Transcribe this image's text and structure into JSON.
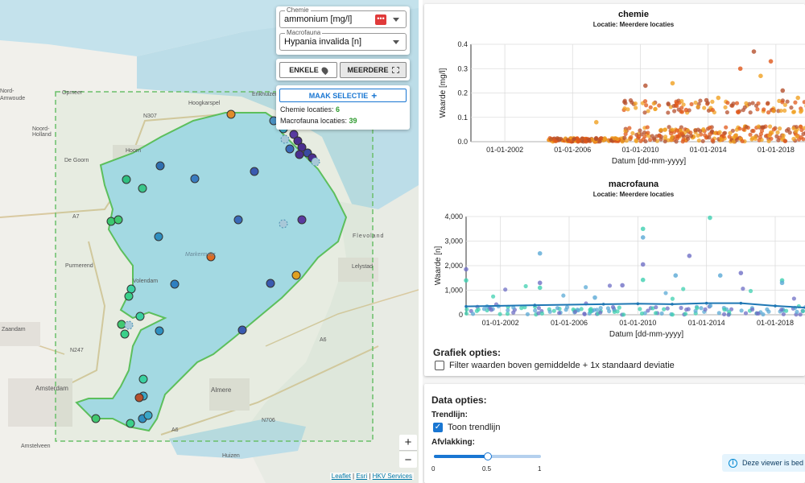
{
  "map": {
    "labels": [
      "Opmeer",
      "Hoogkarspel",
      "Enkhuizen",
      "Noord-\nHolland",
      "Hoorn",
      "De Goorn",
      "Purmerend",
      "Volendam",
      "Zaandam",
      "Amsterdam",
      "Almere",
      "Lelystad",
      "Flevoland",
      "Amstelveen",
      "Huizen",
      "Markermeer",
      "Monnickendam",
      "Hoofdweg",
      "A7",
      "N307",
      "N247",
      "A6",
      "N706",
      "A1",
      "A6",
      "Nord-",
      "Amwoude"
    ],
    "zoom_in": "+",
    "zoom_out": "−",
    "attribution": {
      "leaflet": "Leaflet",
      "sep1": " | ",
      "esri": "Esri",
      "sep2": " | ",
      "hkv": "HKV Services"
    }
  },
  "controls": {
    "chemie_label": "Chemie",
    "chemie_value": "ammonium [mg/l]",
    "macrofauna_label": "Macrofauna",
    "macrofauna_value": "Hypania invalida [n]",
    "enkele": "ENKELE",
    "meerdere": "MEERDERE",
    "maak_selectie": "MAAK SELECTIE",
    "plus": "+",
    "chemie_locaties_label": "Chemie locaties: ",
    "chemie_locaties": "6",
    "macrofauna_locaties_label": "Macrofauna locaties: ",
    "macrofauna_locaties": "39"
  },
  "charts": {
    "chemie": {
      "title": "chemie",
      "subtitle": "Locatie: Meerdere locaties",
      "ylabel": "Waarde [mg/l]",
      "xlabel": "Datum [dd-mm-yyyy]",
      "yticks": [
        "0.4",
        "0.3",
        "0.2",
        "0.1",
        "0.0"
      ],
      "xticks": [
        "01-01-2002",
        "01-01-2006",
        "01-01-2010",
        "01-01-2014",
        "01-01-2018"
      ]
    },
    "macrofauna": {
      "title": "macrofauna",
      "subtitle": "Locatie: Meerdere locaties",
      "ylabel": "Waarde [n]",
      "xlabel": "Datum [dd-mm-yyyy]",
      "yticks": [
        "4,000",
        "3,000",
        "2,000",
        "1,000",
        "0"
      ],
      "xticks": [
        "01-01-2002",
        "01-01-2006",
        "01-01-2010",
        "01-01-2014",
        "01-01-2018"
      ]
    }
  },
  "grafiek_opties": {
    "title": "Grafiek opties:",
    "filter_label": "Filter waarden boven gemiddelde + 1x standaard deviatie",
    "filter_checked": false
  },
  "data_opties": {
    "title": "Data opties:",
    "trendlijn_title": "Trendlijn:",
    "toon_trendlijn": "Toon trendlijn",
    "toon_checked": true,
    "afvlakking_title": "Afvlakking:",
    "slider_min": "0",
    "slider_value": "0.5",
    "slider_max": "1",
    "slider_fraction": 0.5
  },
  "toast": {
    "text": "Deze viewer is bed"
  },
  "colors": {
    "primary": "#1976d2",
    "lake": "#a8dcec",
    "lake_border": "#5bbf5b",
    "selection": "#6abf6a"
  },
  "chart_data": [
    {
      "type": "scatter",
      "title": "chemie",
      "subtitle": "Locatie: Meerdere locaties",
      "xlabel": "Datum [dd-mm-yyyy]",
      "ylabel": "Waarde [mg/l]",
      "ylim": [
        0,
        0.4
      ],
      "xlim": [
        "01-01-2000",
        "01-01-2021"
      ],
      "series_colors": [
        "#e0581a",
        "#b5502d",
        "#f0a020"
      ],
      "points_sample": [
        [
          2005.2,
          0.01
        ],
        [
          2007.4,
          0.08
        ],
        [
          2009.9,
          0.02
        ],
        [
          2010.3,
          0.23
        ],
        [
          2011.9,
          0.24
        ],
        [
          2012.7,
          0.13
        ],
        [
          2013.9,
          0.17
        ],
        [
          2014.6,
          0.18
        ],
        [
          2015.9,
          0.3
        ],
        [
          2016.7,
          0.37
        ],
        [
          2017.1,
          0.27
        ],
        [
          2017.7,
          0.33
        ],
        [
          2018.4,
          0.21
        ],
        [
          2019.3,
          0.18
        ],
        [
          2020.2,
          0.14
        ]
      ]
    },
    {
      "type": "scatter",
      "title": "macrofauna",
      "subtitle": "Locatie: Meerdere locaties",
      "xlabel": "Datum [dd-mm-yyyy]",
      "ylabel": "Waarde [n]",
      "ylim": [
        0,
        4000
      ],
      "xlim": [
        "01-01-2000",
        "01-01-2021"
      ],
      "series_colors": [
        "#5aa9d6",
        "#6f6fc6",
        "#3fd0b0"
      ],
      "points_sample": [
        [
          2000,
          1850
        ],
        [
          2000,
          1400
        ],
        [
          2004.3,
          2500
        ],
        [
          2004.3,
          1300
        ],
        [
          2004.3,
          1100
        ],
        [
          2007.5,
          700
        ],
        [
          2009.1,
          1200
        ],
        [
          2010.3,
          3500
        ],
        [
          2010.3,
          3150
        ],
        [
          2010.3,
          2050
        ],
        [
          2010.3,
          1420
        ],
        [
          2012.2,
          1600
        ],
        [
          2013.0,
          2400
        ],
        [
          2014.2,
          3950
        ],
        [
          2014.8,
          1600
        ],
        [
          2016.0,
          1700
        ],
        [
          2018.4,
          1400
        ],
        [
          2018.4,
          1300
        ]
      ],
      "trendline": [
        [
          2000,
          340
        ],
        [
          2004,
          390
        ],
        [
          2008,
          430
        ],
        [
          2010,
          450
        ],
        [
          2012,
          430
        ],
        [
          2014,
          470
        ],
        [
          2016,
          470
        ],
        [
          2018,
          360
        ],
        [
          2020,
          280
        ],
        [
          2021,
          200
        ]
      ]
    }
  ]
}
